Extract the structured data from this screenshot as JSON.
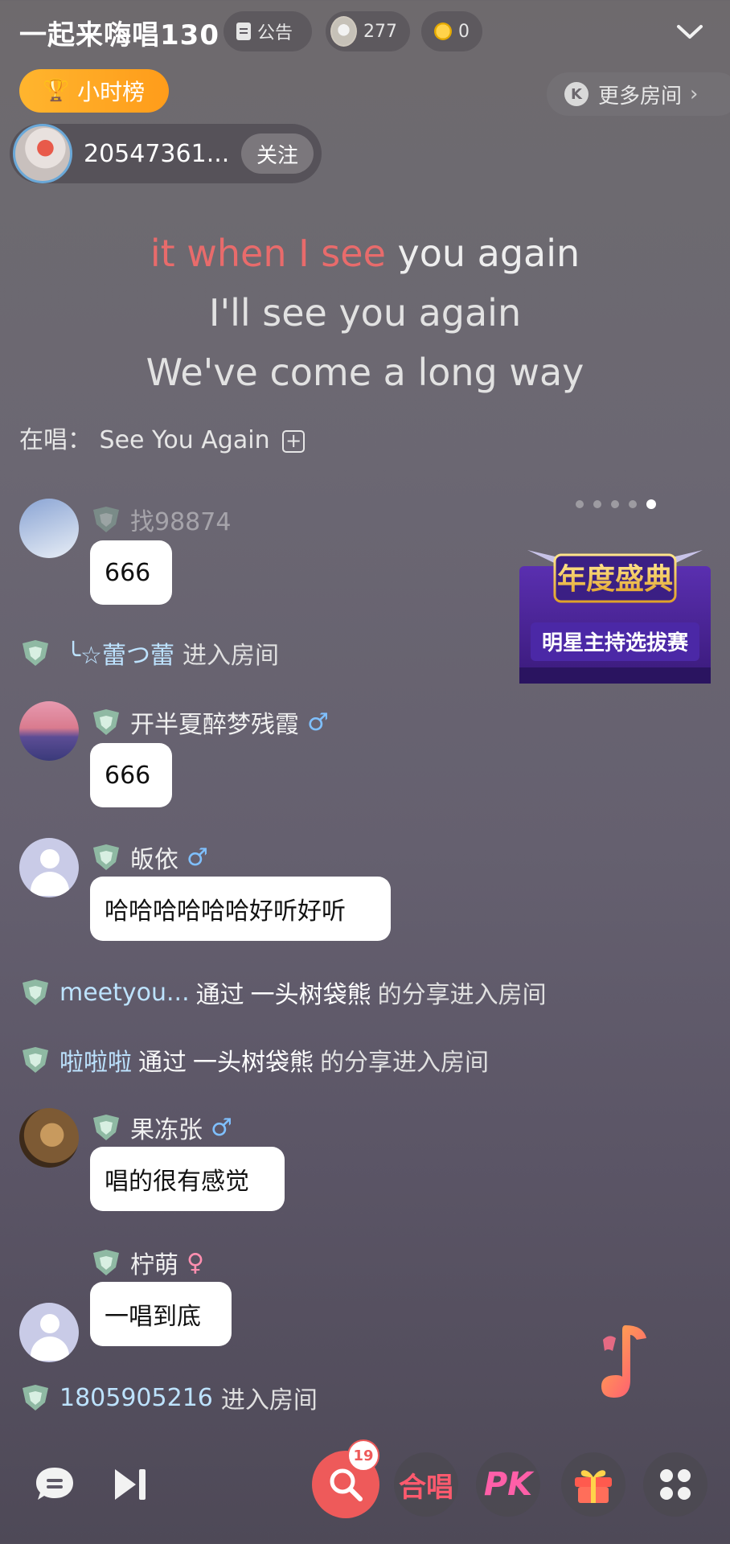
{
  "header": {
    "room_title": "一起来嗨唱130",
    "notice_label": "公告",
    "audience_count": "277",
    "coin_count": "0",
    "rank_label": "小时榜",
    "more_rooms_label": "更多房间",
    "host_name": "20547361...",
    "follow_label": "关注"
  },
  "lyrics": {
    "line1_sung": "it when I see",
    "line1_rest": "you again",
    "line2": "I'll see you again",
    "line3": "We've come a long way",
    "now_playing_prefix": "在唱：",
    "now_playing_song": "See You Again"
  },
  "banner": {
    "title": "年度盛典",
    "subtitle": "明星主持选拔赛"
  },
  "chat": {
    "msg0_name": "找98874",
    "msg0_text": "666",
    "join1_user": "╰☆蕾つ蕾",
    "join1_suffix": "进入房间",
    "msg1_name": "开半夏醉梦残霞",
    "msg1_text": "666",
    "msg2_name": "皈依",
    "msg2_text": "哈哈哈哈哈哈好听好听",
    "share1_user": "meetyou...",
    "share1_via": "通过",
    "share1_sharer": "一头树袋熊",
    "share1_suffix": "的分享进入房间",
    "share2_user": "啦啦啦",
    "share2_via": "通过",
    "share2_sharer": "一头树袋熊",
    "share2_suffix": "的分享进入房间",
    "msg3_name": "果冻张",
    "msg3_text": "唱的很有感觉",
    "msg4_name": "柠萌",
    "msg4_text": "一唱到底",
    "join2_user": "1805905216",
    "join2_suffix": "进入房间"
  },
  "bottom": {
    "queue_count": "19",
    "chorus_label": "合唱",
    "pk_label": "PK"
  },
  "colors": {
    "accent_red": "#ee5a5a",
    "rank_orange": "#ffa622",
    "lyric_highlight": "#e86b6b"
  }
}
